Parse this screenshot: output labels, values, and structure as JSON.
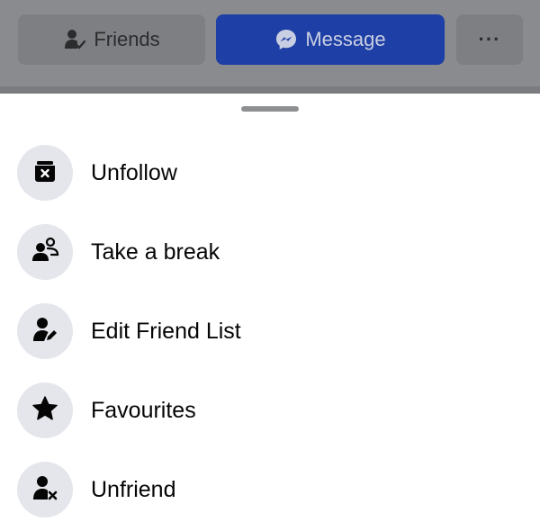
{
  "actions": {
    "friends_label": "Friends",
    "message_label": "Message",
    "more_label": "···"
  },
  "menu": {
    "items": [
      {
        "label": "Unfollow",
        "icon": "unfollow-box-icon"
      },
      {
        "label": "Take a break",
        "icon": "take-a-break-icon"
      },
      {
        "label": "Edit Friend List",
        "icon": "edit-friend-list-icon"
      },
      {
        "label": "Favourites",
        "icon": "star-icon"
      },
      {
        "label": "Unfriend",
        "icon": "unfriend-icon"
      }
    ]
  },
  "colors": {
    "scrim": "#8a8b8e",
    "message_button": "#1e3fa5",
    "icon_circle": "#e4e6eb",
    "text": "#050505"
  }
}
